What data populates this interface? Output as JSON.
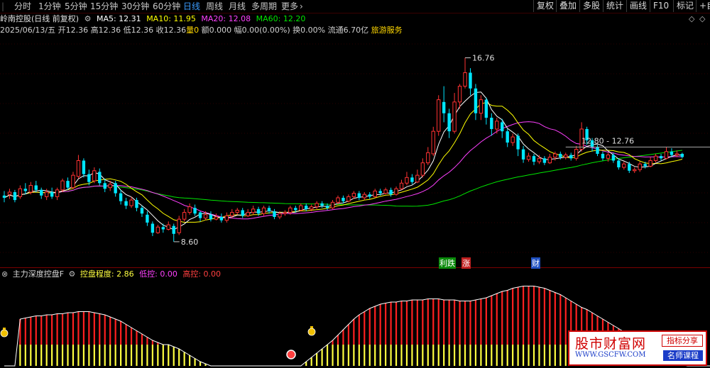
{
  "toolbar": {
    "left_edge": "|",
    "periods": [
      "分时",
      "1分钟",
      "5分钟",
      "15分钟",
      "30分钟",
      "60分钟",
      "日线",
      "周线",
      "月线",
      "多周期",
      "更多"
    ],
    "more_caret": "›",
    "active_period": "日线",
    "buttons": [
      "复权",
      "叠加",
      "多股",
      "统计",
      "画线",
      "F10",
      "标记",
      "+自"
    ]
  },
  "header": {
    "title": "岭南控股(日线 前复权)",
    "ma5": "MA5: 12.31",
    "ma10": "MA10: 11.95",
    "ma20": "MA20: 12.08",
    "ma60": "MA60: 12.20",
    "date": "2025/06/13/五",
    "open": "开12.36",
    "high": "高12.36",
    "low": "低12.36",
    "close": "收12.36",
    "volume": "量0",
    "amount": "额0.000",
    "change": "幅0.00(0.00%)",
    "turnover": "换0.00%",
    "float_cap": "流通6.70亿",
    "sector": "旅游服务"
  },
  "indicator": {
    "name": "主力深度控盘F",
    "control_label": "控盘程度: 2.86",
    "low_label": "低控: 0.00",
    "high_label": "高控: 0.00"
  },
  "markers": {
    "m1": "利跌",
    "m2": "涨",
    "m3": "财"
  },
  "watermark": {
    "title": "股市财富网",
    "url": "WWW.GSCFW.COM",
    "tag1": "指标分享",
    "tag2": "名师课程"
  },
  "colors": {
    "bg": "#000000",
    "up": "#ff3232",
    "down": "#00e6ff",
    "ma5": "#ffffff",
    "ma10": "#ffff00",
    "ma20": "#ff40ff",
    "ma60": "#00e600",
    "active_tab": "#3b9cff",
    "bar_red": "#ff2020",
    "bar_magenta": "#e030e0",
    "bar_yellow": "#ffff40"
  },
  "chart_data": {
    "type": "candlestick",
    "title": "岭南控股(日线 前复权)",
    "ylim": [
      8.0,
      17.5
    ],
    "annotations": [
      "16.76",
      "8.60",
      "12.80 - 12.76"
    ],
    "candles": [
      [
        10.65,
        10.55,
        10.85,
        10.35
      ],
      [
        10.7,
        10.8,
        10.95,
        10.5
      ],
      [
        10.8,
        10.45,
        10.9,
        10.35
      ],
      [
        10.6,
        10.95,
        11.1,
        10.5
      ],
      [
        10.95,
        10.85,
        11.2,
        10.7
      ],
      [
        10.8,
        11.1,
        11.25,
        10.7
      ],
      [
        11.1,
        10.9,
        11.3,
        10.8
      ],
      [
        10.9,
        10.65,
        11.0,
        10.5
      ],
      [
        10.6,
        10.8,
        10.95,
        10.45
      ],
      [
        10.8,
        10.6,
        11.0,
        10.5
      ],
      [
        10.6,
        10.9,
        11.0,
        10.45
      ],
      [
        10.9,
        11.3,
        11.4,
        10.8
      ],
      [
        11.3,
        11.0,
        11.45,
        10.9
      ],
      [
        11.0,
        11.55,
        11.7,
        10.95
      ],
      [
        11.5,
        12.2,
        12.45,
        11.4
      ],
      [
        12.2,
        11.6,
        12.3,
        11.45
      ],
      [
        11.6,
        11.25,
        11.8,
        11.1
      ],
      [
        11.3,
        11.75,
        11.9,
        11.2
      ],
      [
        11.7,
        11.2,
        11.85,
        11.1
      ],
      [
        11.2,
        10.95,
        11.4,
        10.8
      ],
      [
        11.0,
        11.15,
        11.3,
        10.85
      ],
      [
        11.2,
        10.75,
        11.3,
        10.6
      ],
      [
        10.75,
        10.4,
        10.9,
        10.25
      ],
      [
        10.4,
        10.2,
        10.55,
        10.05
      ],
      [
        10.2,
        10.45,
        10.6,
        10.1
      ],
      [
        10.45,
        10.1,
        10.55,
        9.95
      ],
      [
        10.1,
        9.85,
        10.2,
        9.7
      ],
      [
        9.8,
        9.45,
        9.95,
        9.3
      ],
      [
        9.4,
        9.0,
        9.5,
        8.85
      ],
      [
        9.0,
        9.25,
        9.35,
        8.95
      ],
      [
        9.25,
        9.15,
        9.4,
        9.0
      ],
      [
        9.15,
        9.35,
        9.5,
        9.1
      ],
      [
        9.3,
        8.95,
        9.4,
        8.6
      ],
      [
        9.0,
        9.6,
        9.75,
        8.9
      ],
      [
        9.6,
        9.9,
        10.05,
        9.5
      ],
      [
        9.9,
        10.15,
        10.3,
        9.8
      ],
      [
        10.1,
        9.85,
        10.25,
        9.75
      ],
      [
        9.9,
        9.65,
        9.95,
        9.5
      ],
      [
        9.65,
        9.8,
        9.95,
        9.55
      ],
      [
        9.8,
        9.6,
        9.95,
        9.5
      ],
      [
        9.6,
        9.7,
        9.85,
        9.55
      ],
      [
        9.7,
        9.55,
        9.85,
        9.45
      ],
      [
        9.55,
        9.75,
        9.9,
        9.45
      ],
      [
        9.75,
        9.9,
        10.05,
        9.65
      ],
      [
        9.9,
        10.0,
        10.1,
        9.8
      ],
      [
        10.0,
        9.75,
        10.1,
        9.65
      ],
      [
        9.75,
        9.9,
        10.05,
        9.7
      ],
      [
        9.9,
        10.05,
        10.2,
        9.8
      ],
      [
        10.05,
        9.85,
        10.15,
        9.75
      ],
      [
        9.85,
        10.1,
        10.2,
        9.75
      ],
      [
        10.1,
        9.95,
        10.2,
        9.85
      ],
      [
        9.95,
        9.7,
        10.05,
        9.6
      ],
      [
        9.7,
        9.85,
        9.95,
        9.6
      ],
      [
        9.85,
        9.9,
        10.0,
        9.75
      ],
      [
        9.9,
        10.1,
        10.2,
        9.8
      ],
      [
        10.1,
        10.0,
        10.2,
        9.9
      ],
      [
        10.0,
        10.2,
        10.3,
        9.95
      ],
      [
        10.2,
        10.05,
        10.3,
        9.95
      ],
      [
        10.05,
        10.15,
        10.25,
        9.95
      ],
      [
        10.15,
        10.3,
        10.4,
        10.05
      ],
      [
        10.3,
        10.2,
        10.4,
        10.1
      ],
      [
        10.2,
        10.1,
        10.3,
        10.0
      ],
      [
        10.1,
        10.35,
        10.45,
        10.05
      ],
      [
        10.35,
        10.55,
        10.65,
        10.25
      ],
      [
        10.55,
        10.4,
        10.65,
        10.3
      ],
      [
        10.4,
        10.6,
        10.7,
        10.35
      ],
      [
        10.6,
        10.75,
        10.85,
        10.5
      ],
      [
        10.75,
        10.55,
        10.85,
        10.45
      ],
      [
        10.55,
        10.7,
        10.8,
        10.45
      ],
      [
        10.7,
        10.6,
        10.8,
        10.5
      ],
      [
        10.6,
        10.85,
        10.95,
        10.55
      ],
      [
        10.85,
        10.75,
        10.95,
        10.65
      ],
      [
        10.75,
        10.9,
        11.0,
        10.7
      ],
      [
        10.9,
        10.7,
        11.0,
        10.6
      ],
      [
        10.7,
        10.95,
        11.05,
        10.65
      ],
      [
        10.95,
        11.2,
        11.35,
        10.9
      ],
      [
        11.2,
        11.45,
        11.7,
        11.1
      ],
      [
        11.45,
        11.25,
        11.6,
        11.15
      ],
      [
        11.25,
        11.55,
        11.8,
        11.2
      ],
      [
        11.55,
        12.1,
        12.3,
        11.45
      ],
      [
        12.1,
        12.55,
        12.8,
        12.0
      ],
      [
        12.5,
        13.5,
        13.7,
        12.4
      ],
      [
        13.5,
        14.9,
        15.1,
        13.3
      ],
      [
        14.8,
        14.3,
        15.5,
        13.9
      ],
      [
        14.3,
        13.5,
        14.5,
        13.2
      ],
      [
        13.5,
        14.8,
        15.2,
        13.4
      ],
      [
        14.8,
        15.5,
        15.6,
        14.5
      ],
      [
        15.5,
        16.1,
        16.76,
        15.4
      ],
      [
        16.1,
        15.4,
        16.3,
        15.1
      ],
      [
        15.4,
        14.3,
        15.6,
        14.0
      ],
      [
        14.3,
        14.9,
        15.1,
        14.0
      ],
      [
        14.9,
        14.1,
        15.0,
        13.8
      ],
      [
        14.1,
        13.6,
        14.3,
        13.3
      ],
      [
        13.6,
        13.95,
        14.1,
        13.4
      ],
      [
        13.9,
        13.5,
        14.05,
        13.2
      ],
      [
        13.5,
        13.0,
        13.6,
        12.8
      ],
      [
        13.0,
        13.25,
        13.4,
        12.85
      ],
      [
        13.3,
        12.7,
        13.4,
        12.4
      ],
      [
        12.7,
        12.25,
        12.85,
        12.1
      ],
      [
        12.25,
        12.4,
        12.55,
        12.15
      ],
      [
        12.4,
        12.15,
        12.5,
        12.0
      ],
      [
        12.15,
        12.3,
        12.45,
        12.05
      ],
      [
        12.3,
        12.1,
        12.4,
        12.0
      ],
      [
        12.1,
        12.35,
        12.5,
        12.05
      ],
      [
        12.35,
        12.5,
        12.6,
        12.2
      ],
      [
        12.5,
        12.35,
        12.6,
        12.25
      ],
      [
        12.35,
        12.45,
        12.55,
        12.25
      ],
      [
        12.45,
        12.3,
        12.55,
        12.2
      ],
      [
        12.3,
        12.7,
        12.85,
        12.2
      ],
      [
        12.7,
        13.6,
        13.9,
        12.6
      ],
      [
        13.6,
        13.1,
        13.7,
        12.9
      ],
      [
        13.1,
        12.8,
        13.2,
        12.6
      ],
      [
        12.8,
        12.5,
        12.9,
        12.4
      ],
      [
        12.5,
        12.3,
        12.6,
        12.2
      ],
      [
        12.3,
        12.45,
        12.55,
        12.15
      ],
      [
        12.45,
        12.2,
        12.55,
        12.1
      ],
      [
        12.2,
        11.9,
        12.3,
        11.8
      ],
      [
        11.9,
        12.05,
        12.15,
        11.8
      ],
      [
        12.05,
        11.75,
        12.15,
        11.65
      ],
      [
        11.75,
        11.8,
        11.9,
        11.65
      ],
      [
        11.8,
        12.05,
        12.15,
        11.7
      ],
      [
        12.05,
        11.95,
        12.15,
        11.85
      ],
      [
        11.95,
        12.2,
        12.35,
        11.9
      ],
      [
        12.2,
        12.4,
        12.5,
        12.1
      ],
      [
        12.4,
        12.3,
        12.5,
        12.2
      ],
      [
        12.3,
        12.6,
        12.8,
        12.25
      ],
      [
        12.6,
        12.45,
        12.75,
        12.35
      ],
      [
        12.45,
        12.5,
        12.65,
        12.35
      ],
      [
        12.5,
        12.36,
        12.55,
        12.3
      ]
    ],
    "indicator_series": [
      [
        0,
        2,
        2
      ],
      [
        0,
        2,
        2
      ],
      [
        0,
        2,
        2
      ],
      [
        4.4,
        2,
        2
      ],
      [
        4.5,
        2,
        2
      ],
      [
        4.6,
        2,
        2
      ],
      [
        4.7,
        2,
        2
      ],
      [
        4.7,
        2,
        2
      ],
      [
        4.8,
        2,
        2
      ],
      [
        4.8,
        2,
        2
      ],
      [
        4.9,
        2,
        2
      ],
      [
        4.9,
        2,
        2
      ],
      [
        5.0,
        2,
        2
      ],
      [
        5.0,
        2,
        2
      ],
      [
        5.1,
        2,
        2
      ],
      [
        5.1,
        2,
        2
      ],
      [
        5.1,
        2,
        2
      ],
      [
        5.0,
        2,
        2
      ],
      [
        4.9,
        2,
        2
      ],
      [
        4.8,
        2,
        2
      ],
      [
        4.6,
        2,
        2
      ],
      [
        4.4,
        2,
        2
      ],
      [
        4.2,
        2,
        2
      ],
      [
        3.9,
        2,
        2
      ],
      [
        3.6,
        2,
        2
      ],
      [
        3.3,
        2,
        2
      ],
      [
        3.0,
        2,
        2
      ],
      [
        2.7,
        2,
        2
      ],
      [
        2.4,
        2,
        2
      ],
      [
        2.2,
        2,
        2
      ],
      [
        2.0,
        2,
        2
      ],
      [
        2.0,
        2,
        2
      ],
      [
        1.8,
        1.8,
        1.8
      ],
      [
        1.6,
        1.6,
        1.6
      ],
      [
        1.3,
        1.3,
        1.3
      ],
      [
        1.0,
        1.0,
        1.0
      ],
      [
        0.7,
        0.7,
        0.7
      ],
      [
        0.4,
        0.4,
        0.4
      ],
      [
        0.2,
        0.2,
        0.2
      ],
      [
        0.0,
        0.0,
        0.0
      ],
      [
        0,
        0,
        0
      ],
      [
        0,
        0,
        0
      ],
      [
        0,
        0,
        0
      ],
      [
        0,
        0,
        0
      ],
      [
        0,
        0,
        0
      ],
      [
        0,
        0,
        0
      ],
      [
        0,
        0,
        0
      ],
      [
        0,
        0,
        0
      ],
      [
        0,
        0,
        0
      ],
      [
        0,
        0,
        0
      ],
      [
        0,
        0,
        0
      ],
      [
        0,
        0,
        0
      ],
      [
        0,
        0,
        0
      ],
      [
        0,
        0,
        0
      ],
      [
        0,
        0,
        0
      ],
      [
        0,
        0,
        0
      ],
      [
        0,
        0,
        0
      ],
      [
        0.4,
        0.4,
        0.4
      ],
      [
        0.8,
        0.8,
        0.8
      ],
      [
        1.2,
        1.2,
        1.2
      ],
      [
        1.6,
        1.6,
        1.6
      ],
      [
        2.0,
        2.0,
        2.0
      ],
      [
        2.4,
        2,
        2
      ],
      [
        2.9,
        2,
        2
      ],
      [
        3.4,
        2,
        2
      ],
      [
        3.9,
        2,
        2
      ],
      [
        4.4,
        2,
        2
      ],
      [
        4.8,
        2,
        2
      ],
      [
        5.1,
        2,
        2
      ],
      [
        5.4,
        2,
        2
      ],
      [
        5.6,
        2,
        2
      ],
      [
        5.8,
        2,
        2
      ],
      [
        5.9,
        2,
        2
      ],
      [
        6.0,
        2,
        2
      ],
      [
        6.0,
        2,
        2
      ],
      [
        6.1,
        2,
        2
      ],
      [
        6.1,
        2,
        2
      ],
      [
        6.2,
        2,
        2
      ],
      [
        6.2,
        2,
        2
      ],
      [
        6.2,
        2,
        2
      ],
      [
        6.3,
        2,
        2
      ],
      [
        6.3,
        2,
        2
      ],
      [
        6.3,
        2,
        2
      ],
      [
        6.2,
        2,
        2
      ],
      [
        6.2,
        2,
        2
      ],
      [
        6.2,
        2,
        2
      ],
      [
        6.1,
        2,
        2
      ],
      [
        6.1,
        2,
        2
      ],
      [
        6.1,
        2,
        2
      ],
      [
        6.2,
        2,
        2
      ],
      [
        6.3,
        2,
        2
      ],
      [
        6.4,
        2,
        2
      ],
      [
        6.6,
        2,
        2
      ],
      [
        6.8,
        2,
        2
      ],
      [
        7.0,
        2,
        2
      ],
      [
        7.1,
        2,
        2
      ],
      [
        7.3,
        2,
        2
      ],
      [
        7.4,
        2,
        2
      ],
      [
        7.5,
        2,
        2
      ],
      [
        7.5,
        2,
        2
      ],
      [
        7.5,
        2,
        2
      ],
      [
        7.4,
        2,
        2
      ],
      [
        7.3,
        2,
        2
      ],
      [
        7.1,
        2,
        2
      ],
      [
        6.9,
        2,
        2
      ],
      [
        6.7,
        2,
        2
      ],
      [
        6.4,
        2,
        2
      ],
      [
        6.1,
        2,
        2
      ],
      [
        5.8,
        2,
        2
      ],
      [
        5.5,
        2,
        2
      ],
      [
        5.3,
        2,
        2
      ],
      [
        5.0,
        2,
        2
      ],
      [
        4.7,
        2,
        2
      ],
      [
        4.4,
        2,
        2
      ],
      [
        4.1,
        2,
        2
      ],
      [
        3.8,
        2,
        2
      ],
      [
        3.5,
        2,
        2
      ],
      [
        3.2,
        2,
        2
      ],
      [
        2.9,
        2,
        2
      ],
      [
        2.6,
        2,
        2
      ],
      [
        2.3,
        2,
        2
      ],
      [
        2.0,
        2,
        2
      ],
      [
        1.8,
        1.8,
        1.8
      ],
      [
        1.5,
        1.5,
        1.5
      ],
      [
        1.2,
        1.2,
        1.2
      ],
      [
        0.9,
        0.9,
        0.9
      ],
      [
        0.6,
        0.6,
        0.6
      ],
      [
        0.3,
        0.3,
        0.3
      ],
      [
        0.1,
        0.1,
        0.1
      ],
      [
        0,
        0,
        0
      ],
      [
        0,
        0,
        0
      ],
      [
        0,
        0,
        0
      ],
      [
        0,
        0,
        0
      ],
      [
        0,
        0,
        0
      ],
      [
        0,
        0,
        0
      ],
      [
        0,
        0,
        0
      ],
      [
        0,
        0,
        0
      ],
      [
        0,
        0,
        0
      ],
      [
        0,
        0,
        0
      ]
    ]
  }
}
